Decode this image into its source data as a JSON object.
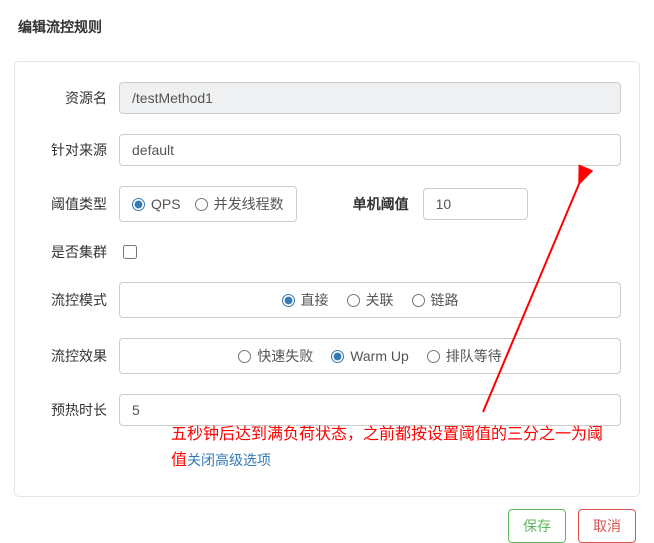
{
  "title": "编辑流控规则",
  "form": {
    "resourceName": {
      "label": "资源名",
      "value": "/testMethod1"
    },
    "limitApp": {
      "label": "针对来源",
      "value": "default"
    },
    "thresholdType": {
      "label": "阈值类型",
      "options": {
        "qps": "QPS",
        "thread": "并发线程数"
      },
      "selected": "qps"
    },
    "singleThreshold": {
      "label": "单机阈值",
      "value": "10"
    },
    "cluster": {
      "label": "是否集群",
      "checked": false
    },
    "mode": {
      "label": "流控模式",
      "options": {
        "direct": "直接",
        "relate": "关联",
        "chain": "链路"
      },
      "selected": "direct"
    },
    "effect": {
      "label": "流控效果",
      "options": {
        "fail": "快速失败",
        "warmup": "Warm Up",
        "queue": "排队等待"
      },
      "selected": "warmup"
    },
    "warmupPeriod": {
      "label": "预热时长",
      "value": "5"
    },
    "advancedLink": "关闭高级选项"
  },
  "annotation": "五秒钟后达到满负荷状态，之前都按设置阈值的三分之一为阈值",
  "buttons": {
    "save": "保存",
    "cancel": "取消"
  }
}
